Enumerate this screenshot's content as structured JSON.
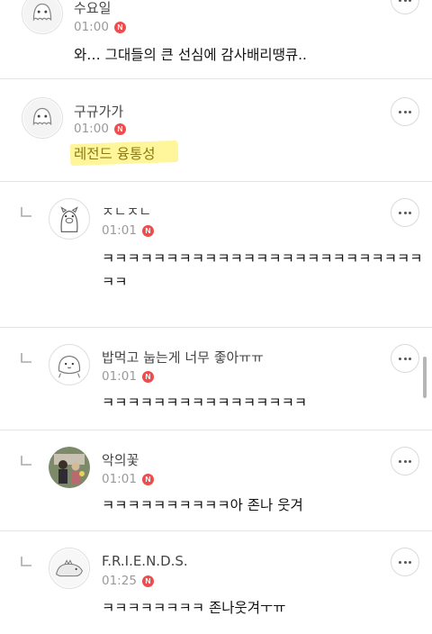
{
  "comments": [
    {
      "author": "수요일",
      "time": "01:00",
      "badge": "N",
      "text": "와… 그대들의 큰 선심에 감사배리땡큐..",
      "avatar_icon": "ghost-face-icon"
    },
    {
      "author": "구규가가",
      "time": "01:00",
      "badge": "N",
      "text": "레전드 융통성",
      "avatar_icon": "ghost-face-icon",
      "highlight_color": "#fff59a"
    },
    {
      "author": "ㅈㄴㅈㄴ",
      "time": "01:01",
      "badge": "N",
      "text": "ㅋㅋㅋㅋㅋㅋㅋㅋㅋㅋㅋㅋㅋㅋㅋㅋㅋㅋㅋㅋㅋㅋㅋㅋㅋㅋㅋ",
      "avatar_icon": "pig-character-icon",
      "reply": true
    },
    {
      "author": "밥먹고 눕는게 너무 좋아ㅠㅠ",
      "time": "01:01",
      "badge": "N",
      "text": "ㅋㅋㅋㅋㅋㅋㅋㅋㅋㅋㅋㅋㅋㅋㅋㅋ",
      "avatar_icon": "blob-character-icon",
      "reply": true
    },
    {
      "author": "악의꽃",
      "time": "01:01",
      "badge": "N",
      "text": "ㅋㅋㅋㅋㅋㅋㅋㅋㅋㅋ아 존나 웃겨",
      "avatar_icon": "photo-avatar-icon",
      "reply": true
    },
    {
      "author": "F.R.I.E.N.D.S.",
      "time": "01:25",
      "badge": "N",
      "text": "ㅋㅋㅋㅋㅋㅋㅋㅋ 존나웃겨ㅜㅠ",
      "avatar_icon": "dinosaur-character-icon",
      "reply": true
    }
  ],
  "colors": {
    "badge": "#ef4d4d",
    "divider": "#e4e4e4",
    "time": "#9a9a9a"
  },
  "icons": {
    "more": "more-dots-icon",
    "reply": "reply-arrow-icon",
    "new": "new-badge-icon"
  }
}
